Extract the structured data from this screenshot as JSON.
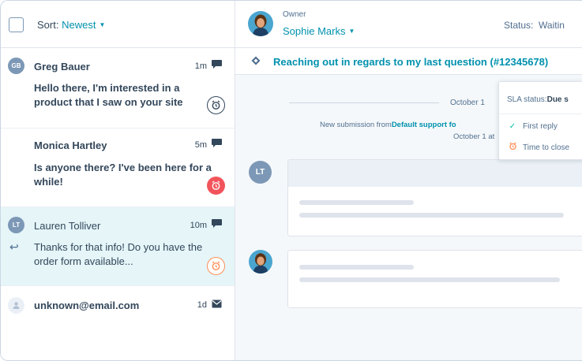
{
  "list": {
    "sort_label": "Sort:",
    "sort_value": "Newest",
    "items": [
      {
        "initials": "GB",
        "name": "Greg Bauer",
        "time": "1m",
        "preview": "Hello there, I'm interested in a product that I saw on your site"
      },
      {
        "initials": "",
        "name": "Monica Hartley",
        "time": "5m",
        "preview": "Is anyone there? I've been here for a while!"
      },
      {
        "initials": "LT",
        "name": "Lauren Tolliver",
        "time": "10m",
        "preview": "Thanks for that info! Do you have the order form available..."
      },
      {
        "initials": "",
        "name": "unknown@email.com",
        "time": "1d",
        "preview": ""
      }
    ]
  },
  "ticket": {
    "owner_label": "Owner",
    "owner_name": "Sophie Marks",
    "status_label": "Status:",
    "status_value": "Waitin",
    "subject": "Reaching out in regards to my last question (#12345678)",
    "date": "October 1",
    "submission_prefix": "New submission from",
    "submission_source": "Default support fo",
    "submission_date": "October 1 at",
    "sender_initials": "LT"
  },
  "sla_popup": {
    "label": "SLA status:",
    "value": "Due s",
    "rows": [
      "First reply",
      "Time to close"
    ]
  },
  "colors": {
    "accent": "#0091ae",
    "selected_row": "#e5f5f8",
    "sla_overdue": "#f2545b",
    "sla_warning": "#ff8f59",
    "avatar": "#7c98b6"
  }
}
